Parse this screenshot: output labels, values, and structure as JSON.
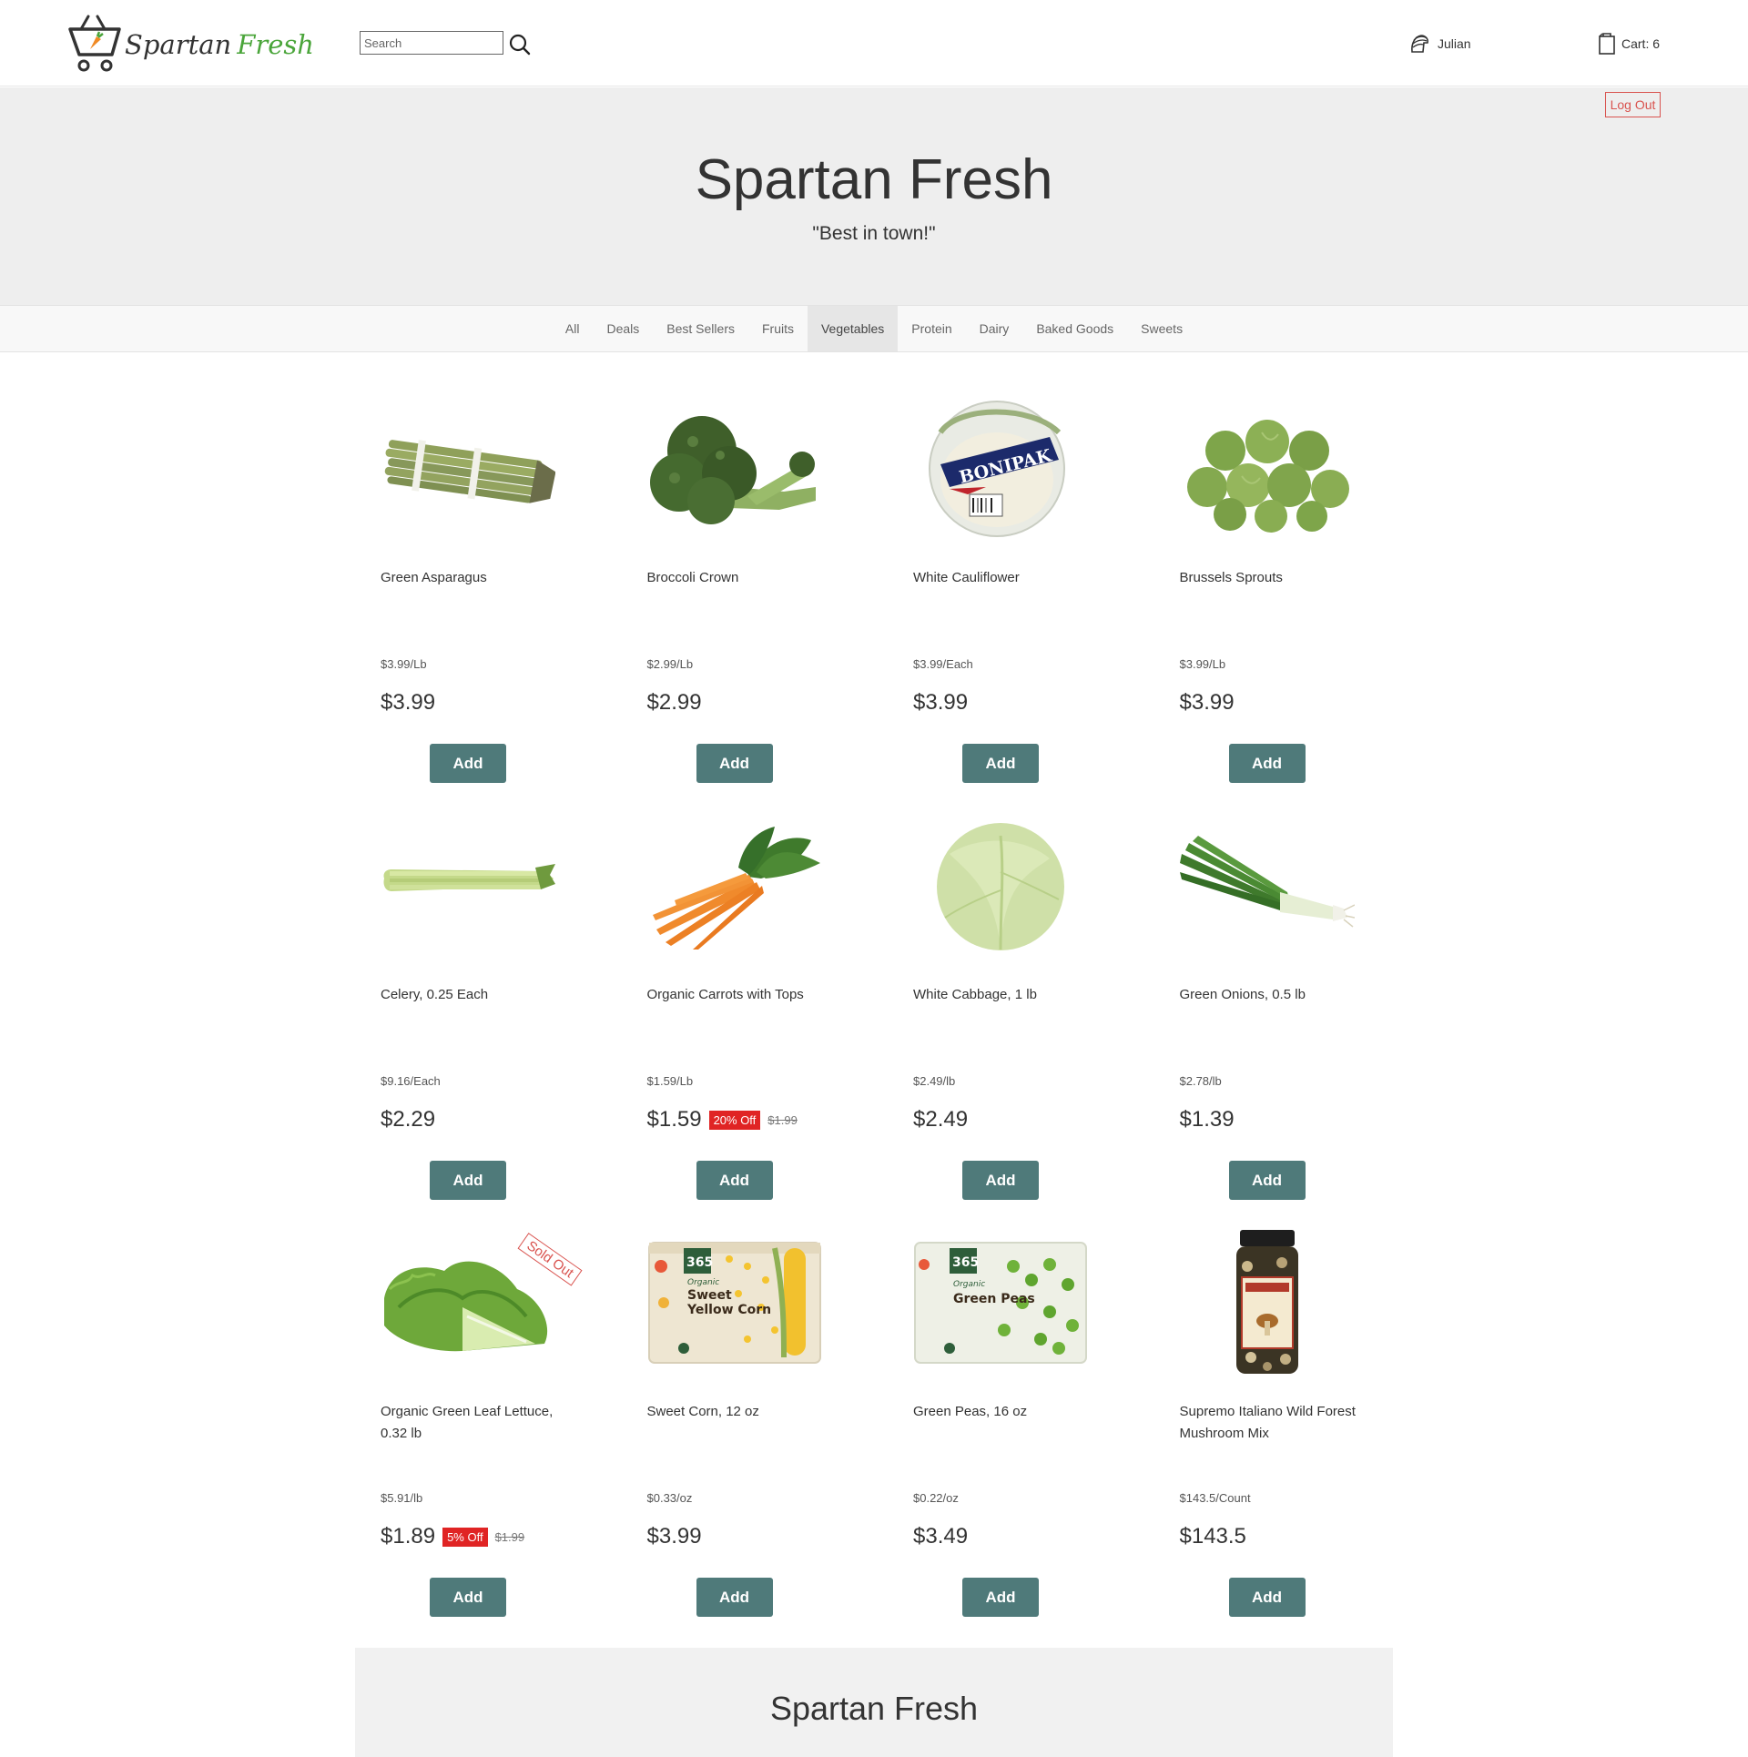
{
  "header": {
    "logo_word1": "Spartan",
    "logo_word2": "Fresh",
    "search_placeholder": "Search",
    "user_name": "Julian",
    "cart_label": "Cart: 6"
  },
  "hero": {
    "logout_label": "Log Out",
    "title": "Spartan Fresh",
    "subtitle": "\"Best in town!\""
  },
  "categories": [
    {
      "label": "All",
      "active": false
    },
    {
      "label": "Deals",
      "active": false
    },
    {
      "label": "Best Sellers",
      "active": false
    },
    {
      "label": "Fruits",
      "active": false
    },
    {
      "label": "Vegetables",
      "active": true
    },
    {
      "label": "Protein",
      "active": false
    },
    {
      "label": "Dairy",
      "active": false
    },
    {
      "label": "Baked Goods",
      "active": false
    },
    {
      "label": "Sweets",
      "active": false
    }
  ],
  "products": [
    {
      "name": "Green Asparagus",
      "unit_price": "$3.99/Lb",
      "price": "$3.99",
      "add_label": "Add",
      "icon": "asparagus-image"
    },
    {
      "name": "Broccoli Crown",
      "unit_price": "$2.99/Lb",
      "price": "$2.99",
      "add_label": "Add",
      "icon": "broccoli-image"
    },
    {
      "name": "White Cauliflower",
      "unit_price": "$3.99/Each",
      "price": "$3.99",
      "add_label": "Add",
      "icon": "cauliflower-image",
      "image_text": "BONIPAK"
    },
    {
      "name": "Brussels Sprouts",
      "unit_price": "$3.99/Lb",
      "price": "$3.99",
      "add_label": "Add",
      "icon": "brussels-sprouts-image"
    },
    {
      "name": "Celery, 0.25 Each",
      "unit_price": "$9.16/Each",
      "price": "$2.29",
      "add_label": "Add",
      "icon": "celery-image"
    },
    {
      "name": "Organic Carrots with Tops",
      "unit_price": "$1.59/Lb",
      "price": "$1.59",
      "discount": "20% Off",
      "old_price": "$1.99",
      "add_label": "Add",
      "icon": "carrots-image"
    },
    {
      "name": "White Cabbage, 1 lb",
      "unit_price": "$2.49/lb",
      "price": "$2.49",
      "add_label": "Add",
      "icon": "cabbage-image"
    },
    {
      "name": "Green Onions, 0.5 lb",
      "unit_price": "$2.78/lb",
      "price": "$1.39",
      "add_label": "Add",
      "icon": "green-onions-image"
    },
    {
      "name": "Organic Green Leaf Lettuce, 0.32 lb",
      "unit_price": "$5.91/lb",
      "price": "$1.89",
      "discount": "5% Off",
      "old_price": "$1.99",
      "sold_out": "Sold Out",
      "add_label": "Add",
      "icon": "lettuce-image"
    },
    {
      "name": "Sweet Corn, 12 oz",
      "unit_price": "$0.33/oz",
      "price": "$3.99",
      "add_label": "Add",
      "icon": "sweet-corn-bag-image",
      "image_text": [
        "365",
        "Organic",
        "Sweet",
        "Yellow Corn"
      ]
    },
    {
      "name": "Green Peas, 16 oz",
      "unit_price": "$0.22/oz",
      "price": "$3.49",
      "add_label": "Add",
      "icon": "green-peas-bag-image",
      "image_text": [
        "365",
        "Organic",
        "Green Peas"
      ]
    },
    {
      "name": "Supremo Italiano Wild Forest Mushroom Mix",
      "unit_price": "$143.5/Count",
      "price": "$143.5",
      "add_label": "Add",
      "icon": "mushroom-jar-image"
    }
  ],
  "footer": {
    "title": "Spartan Fresh"
  },
  "colors": {
    "accent_button": "#4f7a7a",
    "discount_badge": "#e02424",
    "logout": "#d9534f",
    "logo_fresh": "#4aa53a"
  }
}
